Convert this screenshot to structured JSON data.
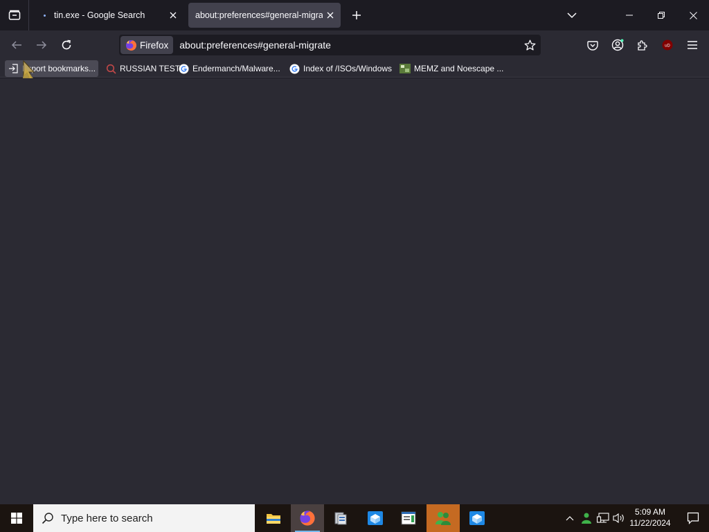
{
  "tabs": [
    {
      "title": "tin.exe - Google Search",
      "active": false
    },
    {
      "title": "about:preferences#general-migrate",
      "active": true
    }
  ],
  "navbar": {
    "identity_label": "Firefox",
    "url": "about:preferences#general-migrate"
  },
  "bookmarks": [
    {
      "label": "Import bookmarks...",
      "icon": "import-icon"
    },
    {
      "label": "RUSSIAN TEST",
      "icon": "magnifier-bookmark-icon"
    },
    {
      "label": "Endermanch/Malware...",
      "icon": "google-icon"
    },
    {
      "label": "Index of /ISOs/Windows",
      "icon": "google-icon"
    },
    {
      "label": "MEMZ and Noescape ...",
      "icon": "image-site-icon"
    }
  ],
  "taskbar": {
    "search_placeholder": "Type here to search",
    "time": "5:09 AM",
    "date": "11/22/2024",
    "apps": [
      "file-explorer",
      "firefox",
      "installer",
      "sandbox-app",
      "notepad-app",
      "msn-messenger",
      "sandbox-app-2"
    ]
  },
  "colors": {
    "chrome_bg": "#1c1b22",
    "toolbar_bg": "#2b2a33",
    "active_tab": "#42414d",
    "taskbar_bg": "#1b1410",
    "accent_blue": "#0078d4"
  }
}
